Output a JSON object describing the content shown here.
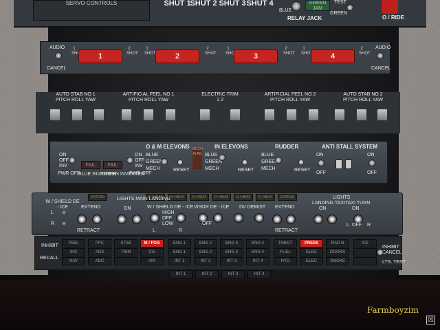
{
  "top": {
    "servo_label": "SERVO CONTROLS",
    "shut": [
      "SHUT 1",
      "SHUT 2",
      "SHUT 3",
      "SHUT 4"
    ],
    "blue": "BLUE",
    "green": "GREEN",
    "green_jam": "GREEN JAM",
    "test": "TEST",
    "relay_jack": "RELAY JACK",
    "oride": "O / RIDE"
  },
  "fire": {
    "audio": "AUDIO",
    "cancel": "CANCEL",
    "handles": [
      "1",
      "2",
      "3",
      "4"
    ],
    "shot1": "1 SHOT",
    "shot2": "2 SHOT"
  },
  "strip": {
    "groups": [
      {
        "title": "AUTO STAB NO 1",
        "sub": "PITCH  ROLL  YAW"
      },
      {
        "title": "ARTIFICIAL FEEL NO 1",
        "sub": "PITCH  ROLL  YAW"
      },
      {
        "title": "ELECTRIC TRIM",
        "sub": "1          2"
      },
      {
        "title": "ARTIFICIAL FEEL NO 2",
        "sub": "PITCH  ROLL  YAW"
      },
      {
        "title": "AUTO STAB NO 2",
        "sub": "PITCH  ROLL  YAW"
      }
    ]
  },
  "mid": {
    "on": "ON",
    "off": "OFF",
    "inv": "INV",
    "pwr_off": "PWR OFF",
    "fail": "FAIL",
    "blue_inverter": "BLUE INVERTER",
    "green_inverter": "GREEN INVERTER",
    "om_elevons": "O & M ELEVONS",
    "in_elevons": "IN  ELEVONS",
    "rudder": "RUDDER",
    "anti_stall": "ANTI STALL SYSTEM",
    "blue": "BLUE",
    "green": "GREEN",
    "mech": "MECH",
    "reset": "RESET",
    "mech_flag": "MECH FLAG"
  },
  "lights": {
    "extend": "EXTEND",
    "lights_main": "LIGHTS MAIN LANDING",
    "on": "ON",
    "wshield_deice": "W / SHIELD DE - ICE",
    "wshield_deice2": "W / SHIELD DE - ICE",
    "high": "HIGH",
    "off": "OFF",
    "low": "LOW",
    "visor_deice": "VISOR DE - ICE",
    "dv_demist": "DV DEMIST",
    "landing_taxi": "LANDING TAXI",
    "lights2": "LIGHTS",
    "taxi_turn": "TAXI TURN",
    "l": "L",
    "r": "R",
    "retract": "RETRACT",
    "ann": [
      "EXTEND",
      "D / HEAT",
      "D / HEAT",
      "D / HEAT",
      "D / HEAT",
      "D / HEAT",
      "D / HEAT",
      "EXTEND"
    ]
  },
  "warn": {
    "inhibit": "INHIBIT",
    "recall": "RECALL",
    "inhibit2": "INHIBIT",
    "cancel": "CANCEL",
    "lts_test": "LTS. TEST",
    "cols": [
      [
        "FEEL",
        "INS",
        "NAV"
      ],
      [
        "PFC",
        "ADS",
        "ADC"
      ],
      [
        "STAB",
        "TRIM",
        ""
      ],
      [
        "M / FOG",
        "CG",
        "AIR"
      ],
      [
        "ENG 1",
        "ENG 1",
        "INT 1"
      ],
      [
        "ENG 2",
        "ENG 2",
        "INT 2"
      ],
      [
        "ENG 3",
        "ENG 3",
        "INT 3"
      ],
      [
        "ENG 4",
        "ENG 4",
        "INT 4"
      ],
      [
        "THROT",
        "FUEL",
        "HYD"
      ],
      [
        "PRESS",
        "ELEC",
        "ELEC"
      ],
      [
        "RAD N",
        "DOORS",
        "SMOKE"
      ],
      [
        "ICE",
        "",
        ""
      ]
    ],
    "int_row": [
      "INT 1",
      "INT 2",
      "INT 3",
      "INT 4"
    ]
  },
  "brand": "Farmboyzim",
  "close_icon": "☒"
}
